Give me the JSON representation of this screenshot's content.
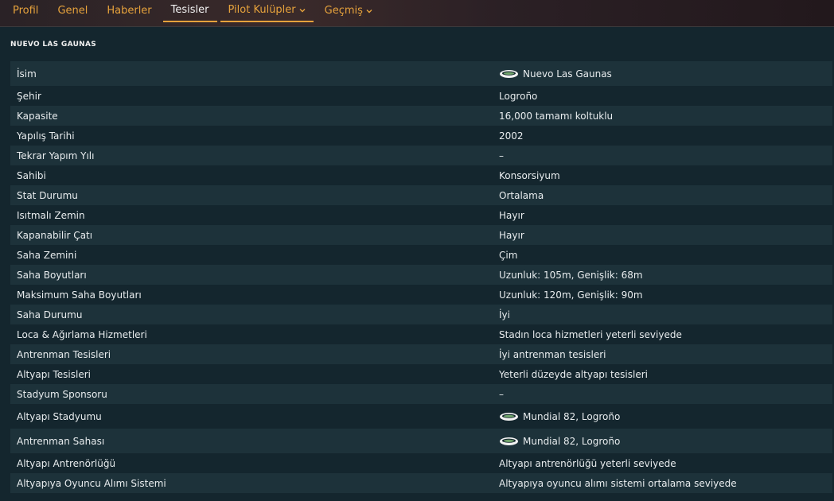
{
  "tabs": [
    {
      "label": "Profil"
    },
    {
      "label": "Genel"
    },
    {
      "label": "Haberler"
    },
    {
      "label": "Tesisler"
    },
    {
      "label": "Pilot Kulüpler"
    },
    {
      "label": "Geçmiş"
    }
  ],
  "section_title": "NUEVO LAS GAUNAS",
  "rows": [
    {
      "label": "İsim",
      "value": "Nuevo Las Gaunas",
      "icon": "stadium-icon"
    },
    {
      "label": "Şehir",
      "value": "Logroño"
    },
    {
      "label": "Kapasite",
      "value": "16,000 tamamı koltuklu"
    },
    {
      "label": "Yapılış Tarihi",
      "value": "2002"
    },
    {
      "label": "Tekrar Yapım Yılı",
      "value": "–"
    },
    {
      "label": "Sahibi",
      "value": "Konsorsiyum"
    },
    {
      "label": "Stat Durumu",
      "value": "Ortalama"
    },
    {
      "label": "Isıtmalı Zemin",
      "value": "Hayır"
    },
    {
      "label": "Kapanabilir Çatı",
      "value": "Hayır"
    },
    {
      "label": "Saha Zemini",
      "value": "Çim"
    },
    {
      "label": "Saha Boyutları",
      "value": "Uzunluk: 105m, Genişlik: 68m"
    },
    {
      "label": "Maksimum Saha Boyutları",
      "value": "Uzunluk: 120m, Genişlik: 90m"
    },
    {
      "label": "Saha Durumu",
      "value": "İyi"
    },
    {
      "label": "Loca & Ağırlama Hizmetleri",
      "value": "Stadın loca hizmetleri yeterli seviyede"
    },
    {
      "label": "Antrenman Tesisleri",
      "value": "İyi antrenman tesisleri"
    },
    {
      "label": "Altyapı Tesisleri",
      "value": "Yeterli düzeyde altyapı tesisleri"
    },
    {
      "label": "Stadyum Sponsoru",
      "value": "–"
    },
    {
      "label": "Altyapı Stadyumu",
      "value": "Mundial 82, Logroño",
      "icon": "stadium-icon"
    },
    {
      "label": "Antrenman Sahası",
      "value": "Mundial 82, Logroño",
      "icon": "stadium-icon"
    },
    {
      "label": "Altyapı Antrenörlüğü",
      "value": "Altyapı antrenörlüğü yeterli seviyede"
    },
    {
      "label": "Altyapıya Oyuncu Alımı Sistemi",
      "value": "Altyapıya oyuncu alımı sistemi ortalama seviyede"
    }
  ],
  "colors": {
    "accent": "#e6a23c",
    "row_alt": "#1d323a",
    "background": "#14262e"
  }
}
